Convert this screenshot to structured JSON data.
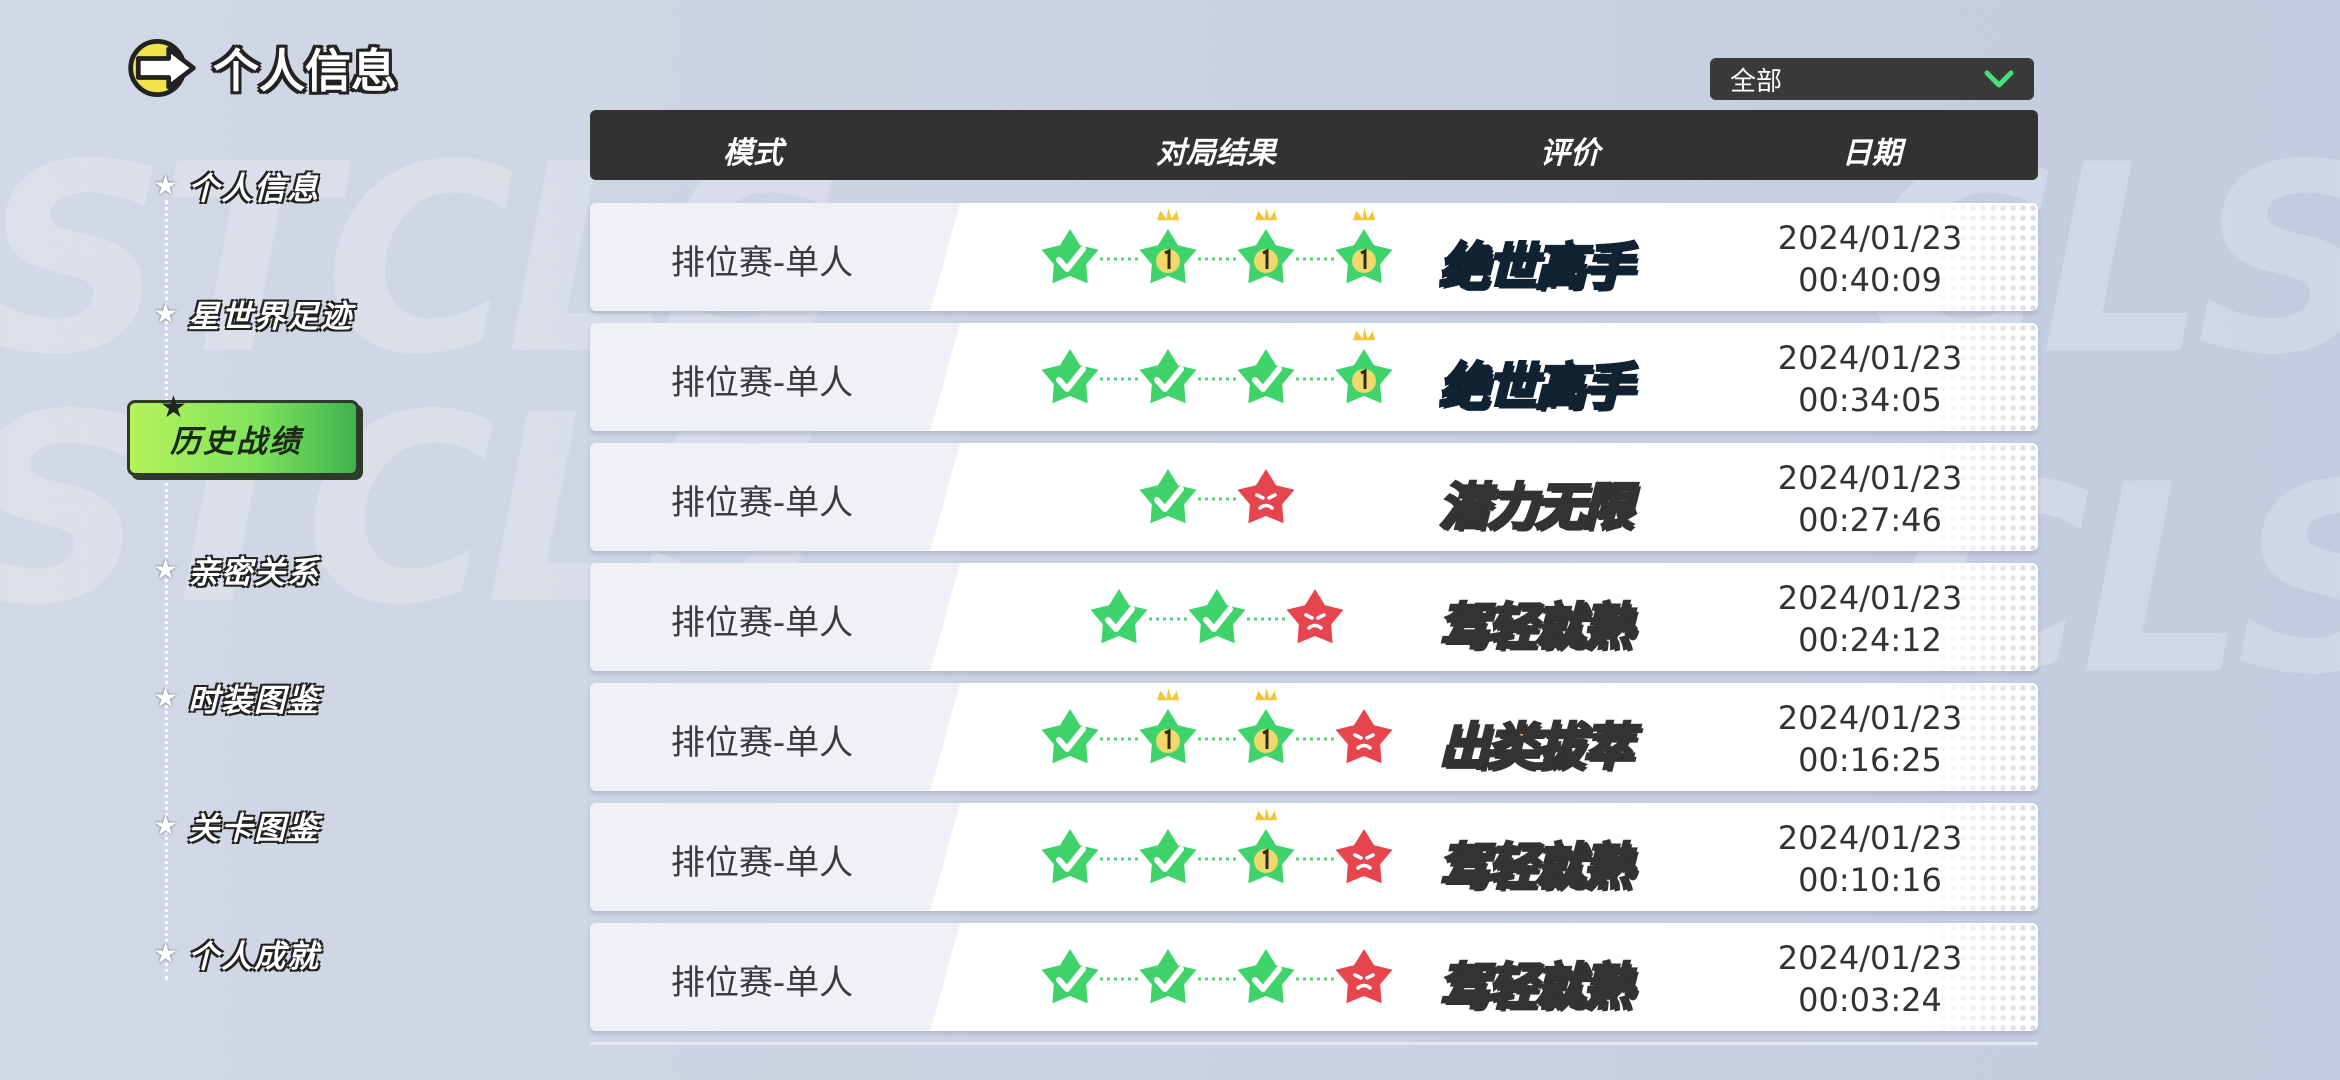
{
  "header": {
    "title": "个人信息",
    "icon": "arrow-logo-icon"
  },
  "filter": {
    "selected": "全部"
  },
  "sidebar": {
    "items": [
      {
        "label": "个人信息",
        "active": false
      },
      {
        "label": "星世界足迹",
        "active": false
      },
      {
        "label": "历史战绩",
        "active": true
      },
      {
        "label": "亲密关系",
        "active": false
      },
      {
        "label": "时装图鉴",
        "active": false
      },
      {
        "label": "关卡图鉴",
        "active": false
      },
      {
        "label": "个人成就",
        "active": false
      }
    ]
  },
  "table": {
    "columns": [
      "模式",
      "对局结果",
      "评价",
      "日期"
    ],
    "rows": [
      {
        "mode": "排位赛-单人",
        "results": [
          "qualified",
          "first",
          "first",
          "first"
        ],
        "rating": "绝世高手",
        "rating_style": "blue",
        "date": "2024/01/23",
        "time": "00:40:09"
      },
      {
        "mode": "排位赛-单人",
        "results": [
          "qualified",
          "qualified",
          "qualified",
          "first"
        ],
        "rating": "绝世高手",
        "rating_style": "blue",
        "date": "2024/01/23",
        "time": "00:34:05"
      },
      {
        "mode": "排位赛-单人",
        "results": [
          "qualified",
          "eliminated"
        ],
        "rating": "潜力无限",
        "rating_style": "gray",
        "date": "2024/01/23",
        "time": "00:27:46"
      },
      {
        "mode": "排位赛-单人",
        "results": [
          "qualified",
          "qualified",
          "eliminated"
        ],
        "rating": "驾轻就熟",
        "rating_style": "gray",
        "date": "2024/01/23",
        "time": "00:24:12"
      },
      {
        "mode": "排位赛-单人",
        "results": [
          "qualified",
          "first",
          "first",
          "eliminated"
        ],
        "rating": "出类拔萃",
        "rating_style": "orange",
        "date": "2024/01/23",
        "time": "00:16:25"
      },
      {
        "mode": "排位赛-单人",
        "results": [
          "qualified",
          "qualified",
          "first",
          "eliminated"
        ],
        "rating": "驾轻就熟",
        "rating_style": "gray",
        "date": "2024/01/23",
        "time": "00:10:16"
      },
      {
        "mode": "排位赛-单人",
        "results": [
          "qualified",
          "qualified",
          "qualified",
          "eliminated"
        ],
        "rating": "驾轻就熟",
        "rating_style": "gray",
        "date": "2024/01/23",
        "time": "00:03:24"
      }
    ]
  },
  "colors": {
    "qualified": "#3ed36b",
    "eliminated": "#e6454d",
    "crown": "#f5c43a",
    "active_nav": "#7fe45c",
    "header_bar": "#323232"
  }
}
